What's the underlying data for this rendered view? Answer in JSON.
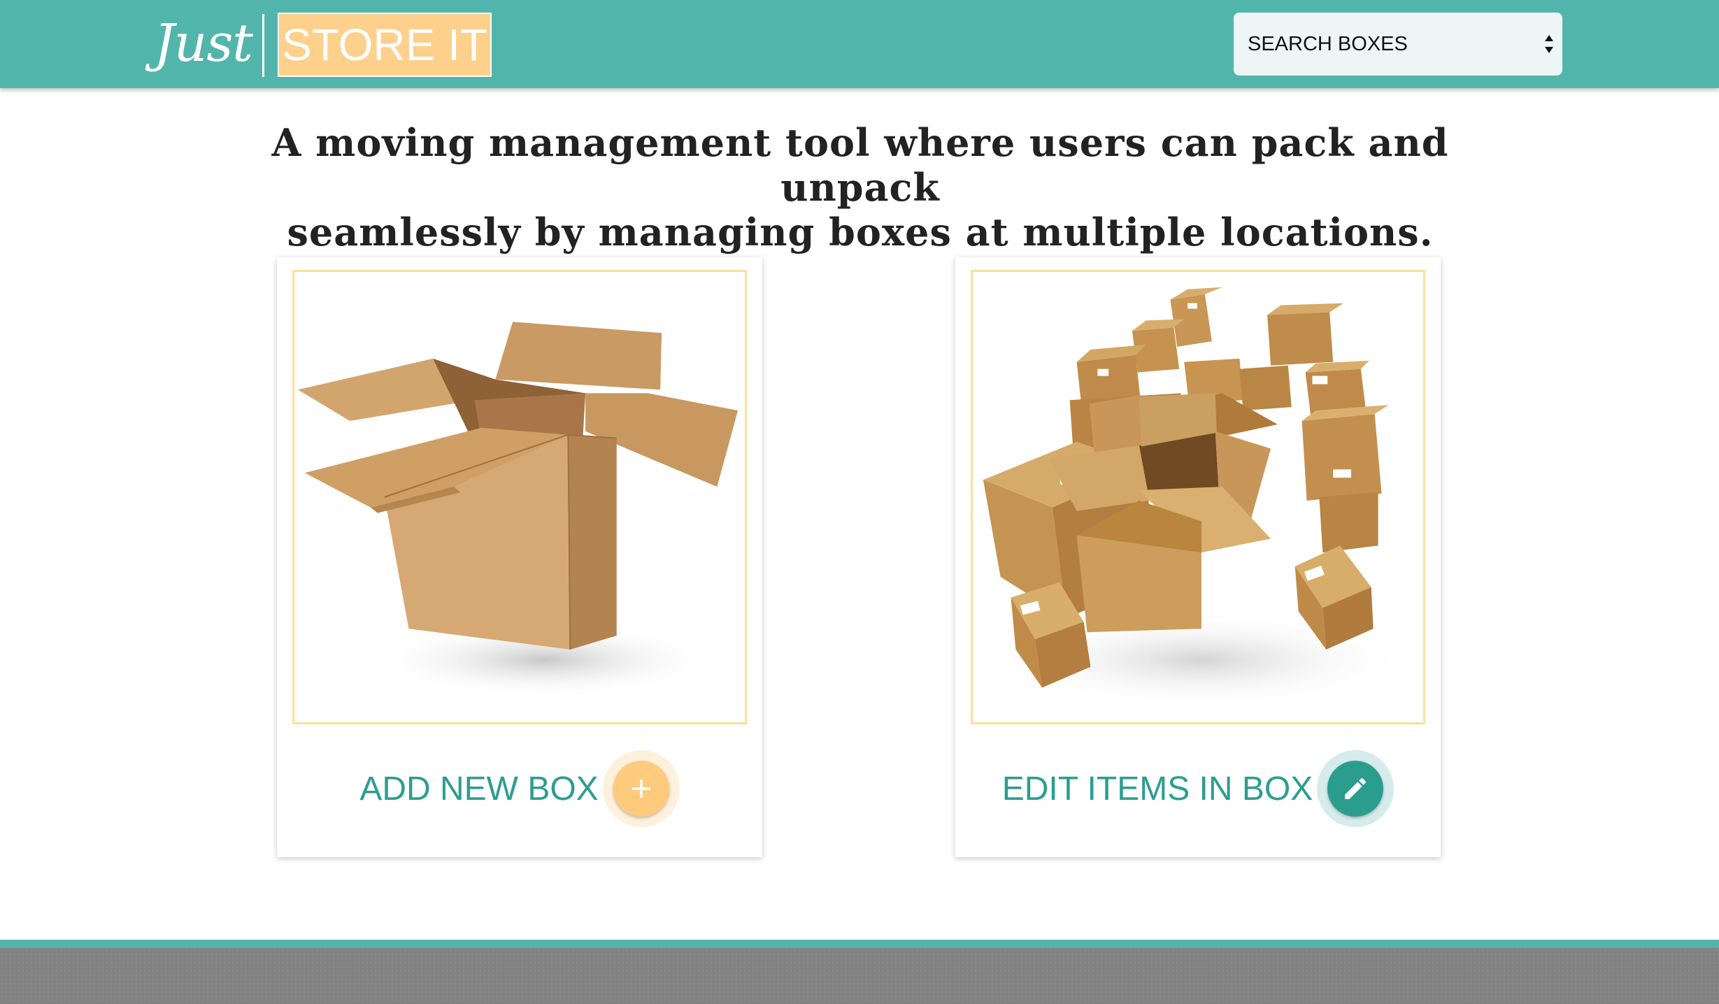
{
  "header": {
    "logo_script": "Just",
    "logo_box": "STORE IT",
    "search_select": {
      "selected": "SEARCH BOXES"
    },
    "colors": {
      "header": "#52b5ab",
      "logo_box": "#fdd08c"
    }
  },
  "tagline": {
    "line1": "A moving management tool where users can pack and unpack",
    "line2": "seamlessly by managing boxes at multiple locations."
  },
  "cards": [
    {
      "label": "ADD NEW BOX",
      "icon": "plus-icon",
      "image": "open-cardboard-box",
      "button_color": "#fecb7c"
    },
    {
      "label": "EDIT ITEMS IN BOX",
      "icon": "pencil-icon",
      "image": "pile-of-cardboard-boxes",
      "button_color": "#2a9d8f"
    }
  ],
  "footer": {
    "color": "#828282",
    "accent": "#52b5ab"
  }
}
